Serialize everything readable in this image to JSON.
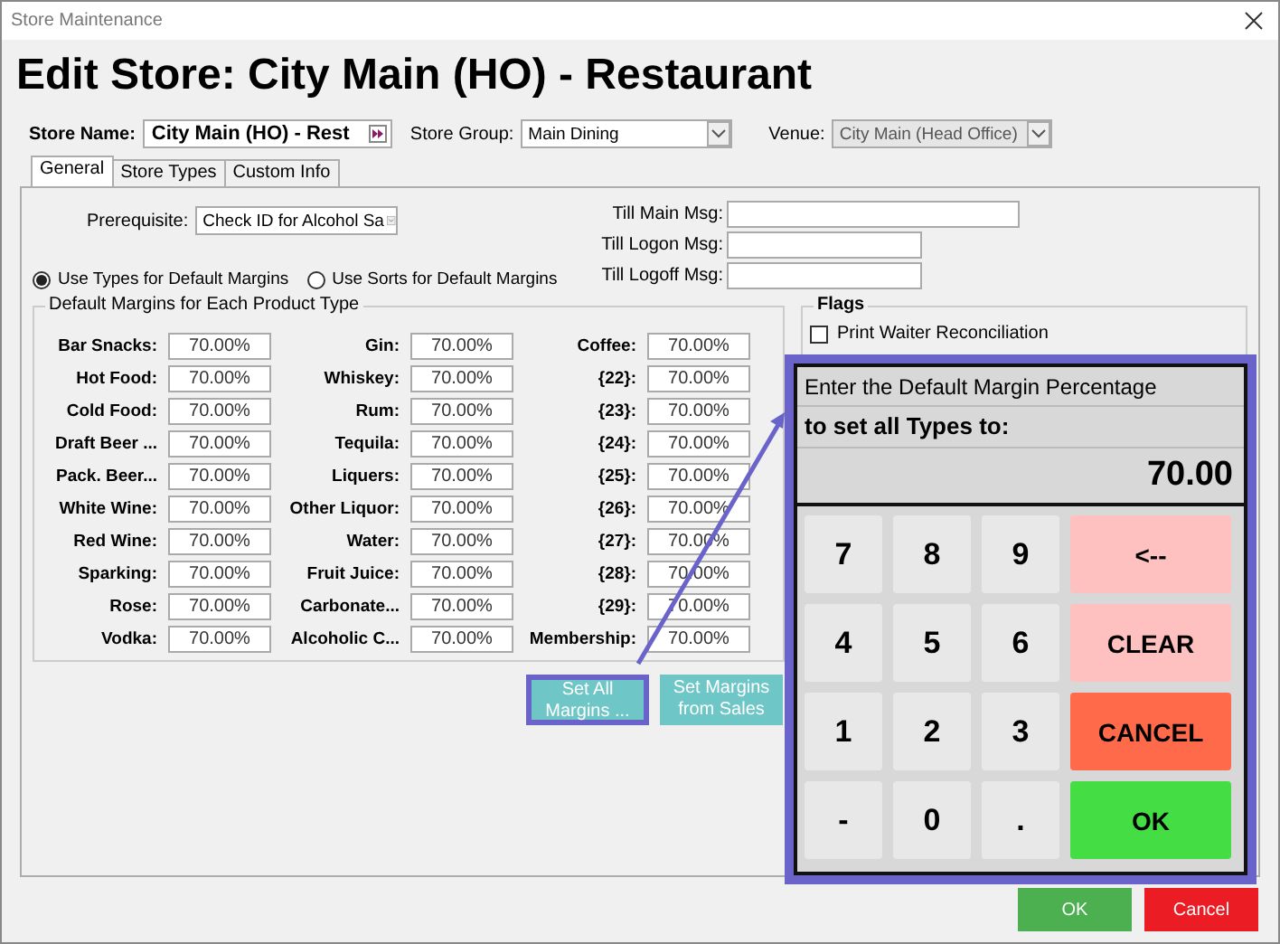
{
  "window": {
    "title": "Store Maintenance"
  },
  "heading": "Edit Store: City Main (HO) - Restaurant",
  "store_name": {
    "label": "Store Name:",
    "value": "City Main (HO) - Rest"
  },
  "store_group": {
    "label": "Store Group:",
    "value": "Main Dining"
  },
  "venue": {
    "label": "Venue:",
    "value": "City Main (Head Office)",
    "disabled": true
  },
  "tabs": [
    {
      "label": "General",
      "selected": true
    },
    {
      "label": "Store Types",
      "selected": false
    },
    {
      "label": "Custom Info",
      "selected": false
    }
  ],
  "prerequisite": {
    "label": "Prerequisite:",
    "value": "Check ID for Alcohol Sa"
  },
  "till_messages": [
    {
      "label": "Till Main Msg:",
      "wide": true
    },
    {
      "label": "Till Logon Msg:",
      "wide": false
    },
    {
      "label": "Till Logoff Msg:",
      "wide": false
    }
  ],
  "margin_mode": [
    {
      "label": "Use Types for Default Margins",
      "selected": true
    },
    {
      "label": "Use Sorts for Default Margins",
      "selected": false
    }
  ],
  "margins": {
    "title": "Default Margins for Each Product Type",
    "items": [
      {
        "label": "Bar Snacks:",
        "value": "70.00%"
      },
      {
        "label": "Hot Food:",
        "value": "70.00%"
      },
      {
        "label": "Cold Food:",
        "value": "70.00%"
      },
      {
        "label": "Draft Beer ...",
        "value": "70.00%"
      },
      {
        "label": "Pack. Beer...",
        "value": "70.00%"
      },
      {
        "label": "White Wine:",
        "value": "70.00%"
      },
      {
        "label": "Red Wine:",
        "value": "70.00%"
      },
      {
        "label": "Sparking:",
        "value": "70.00%"
      },
      {
        "label": "Rose:",
        "value": "70.00%"
      },
      {
        "label": "Vodka:",
        "value": "70.00%"
      },
      {
        "label": "Gin:",
        "value": "70.00%"
      },
      {
        "label": "Whiskey:",
        "value": "70.00%"
      },
      {
        "label": "Rum:",
        "value": "70.00%"
      },
      {
        "label": "Tequila:",
        "value": "70.00%"
      },
      {
        "label": "Liquers:",
        "value": "70.00%"
      },
      {
        "label": "Other Liquor:",
        "value": "70.00%"
      },
      {
        "label": "Water:",
        "value": "70.00%"
      },
      {
        "label": "Fruit Juice:",
        "value": "70.00%"
      },
      {
        "label": "Carbonate...",
        "value": "70.00%"
      },
      {
        "label": "Alcoholic C...",
        "value": "70.00%"
      },
      {
        "label": "Coffee:",
        "value": "70.00%"
      },
      {
        "label": "{22}:",
        "value": "70.00%"
      },
      {
        "label": "{23}:",
        "value": "70.00%"
      },
      {
        "label": "{24}:",
        "value": "70.00%"
      },
      {
        "label": "{25}:",
        "value": "70.00%"
      },
      {
        "label": "{26}:",
        "value": "70.00%"
      },
      {
        "label": "{27}:",
        "value": "70.00%"
      },
      {
        "label": "{28}:",
        "value": "70.00%"
      },
      {
        "label": "{29}:",
        "value": "70.00%"
      },
      {
        "label": "Membership:",
        "value": "70.00%"
      }
    ]
  },
  "margin_buttons": [
    {
      "label": "Set All\nMargins ...",
      "highlighted": true
    },
    {
      "label": "Set Margins\nfrom Sales",
      "highlighted": false
    }
  ],
  "flags": {
    "title": "Flags",
    "items": [
      {
        "label": "Print Waiter Reconciliation",
        "checked": false
      }
    ]
  },
  "keypad": {
    "prompt": "Enter the Default Margin Percentage",
    "prompt_bold": "to set all Types to:",
    "value": "70.00",
    "keys": [
      {
        "label": "7",
        "kind": "digit"
      },
      {
        "label": "8",
        "kind": "digit"
      },
      {
        "label": "9",
        "kind": "digit"
      },
      {
        "label": "<--",
        "kind": "backspace"
      },
      {
        "label": "4",
        "kind": "digit"
      },
      {
        "label": "5",
        "kind": "digit"
      },
      {
        "label": "6",
        "kind": "digit"
      },
      {
        "label": "CLEAR",
        "kind": "clear"
      },
      {
        "label": "1",
        "kind": "digit"
      },
      {
        "label": "2",
        "kind": "digit"
      },
      {
        "label": "3",
        "kind": "digit"
      },
      {
        "label": "CANCEL",
        "kind": "cancel"
      },
      {
        "label": "-",
        "kind": "digit"
      },
      {
        "label": "0",
        "kind": "digit"
      },
      {
        "label": ".",
        "kind": "digit"
      },
      {
        "label": "OK",
        "kind": "ok"
      }
    ]
  },
  "dialog_buttons": [
    {
      "label": "OK",
      "kind": "ok"
    },
    {
      "label": "Cancel",
      "kind": "cancel"
    }
  ]
}
